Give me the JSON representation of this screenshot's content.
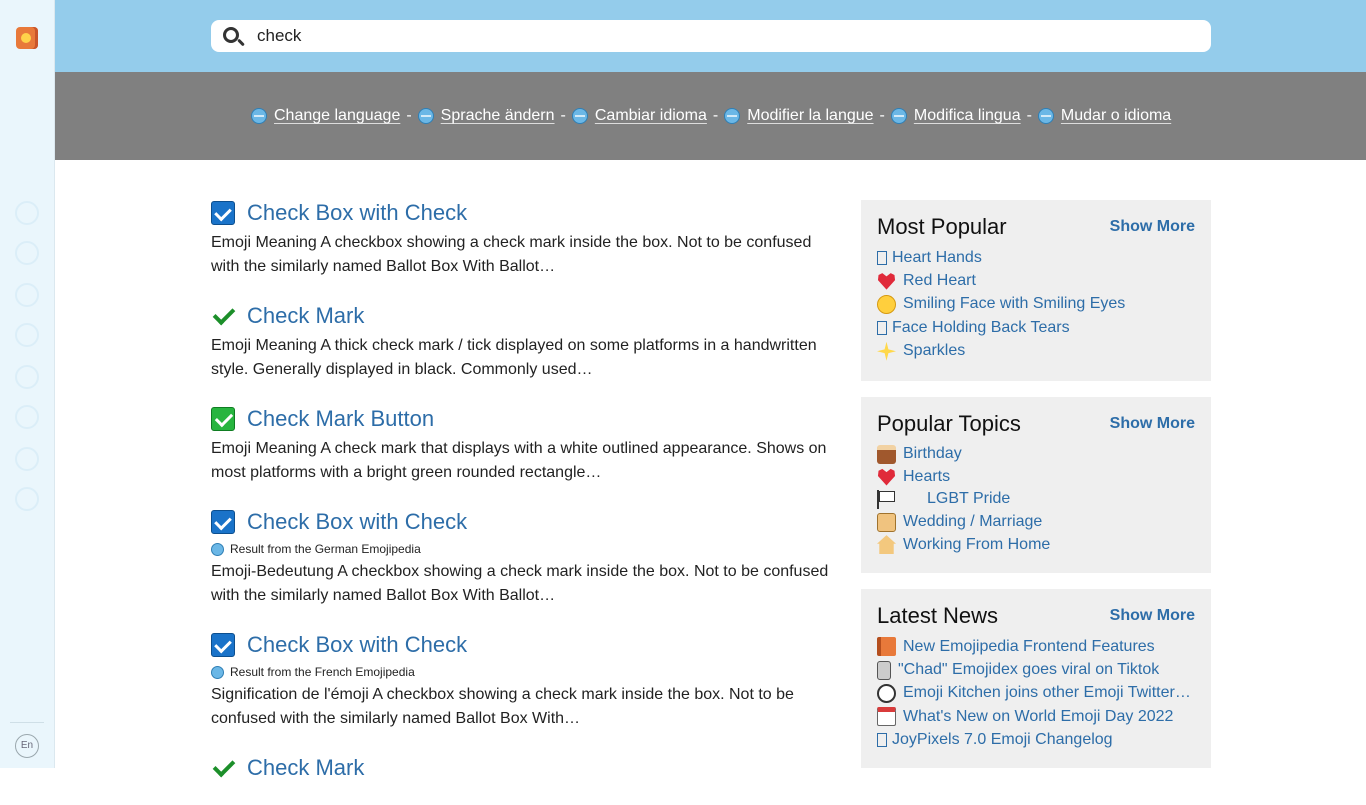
{
  "search": {
    "value": "check",
    "icon": "search-icon"
  },
  "sidebar_rail": {
    "lang_button": "En"
  },
  "languages": [
    {
      "label": "Change language"
    },
    {
      "label": "Sprache ändern"
    },
    {
      "label": "Cambiar idioma"
    },
    {
      "label": "Modifier la langue"
    },
    {
      "label": "Modifica lingua"
    },
    {
      "label": "Mudar o idioma"
    }
  ],
  "results": [
    {
      "title": "Check Box with Check",
      "icon": "check-box-icon",
      "sub": "",
      "desc": "Emoji Meaning A checkbox showing a check mark inside the box. Not to be confused with the similarly named Ballot Box With Ballot…"
    },
    {
      "title": "Check Mark",
      "icon": "check-mark-icon",
      "sub": "",
      "desc": "Emoji Meaning A thick check mark / tick displayed on some platforms in a handwritten style. Generally displayed in black. Commonly used…"
    },
    {
      "title": "Check Mark Button",
      "icon": "check-mark-button-icon",
      "sub": "",
      "desc": "Emoji Meaning A check mark that displays with a white outlined appearance. Shows on most platforms with a bright green rounded rectangle…"
    },
    {
      "title": "Check Box with Check",
      "icon": "check-box-icon",
      "sub": "Result from the German Emojipedia",
      "desc": "Emoji-Bedeutung A checkbox showing a check mark inside the box. Not to be confused with the similarly named Ballot Box With Ballot…"
    },
    {
      "title": "Check Box with Check",
      "icon": "check-box-icon",
      "sub": "Result from the French Emojipedia",
      "desc": "Signification de l'émoji A checkbox showing a check mark inside the box. Not to be confused with the similarly named Ballot Box With…"
    },
    {
      "title": "Check Mark",
      "icon": "check-mark-icon",
      "sub": "",
      "desc": ""
    }
  ],
  "most_popular": {
    "title": "Most Popular",
    "more": "Show More",
    "items": [
      {
        "label": "Heart Hands",
        "icon": "missing-glyph-icon"
      },
      {
        "label": "Red Heart",
        "icon": "red-heart-icon"
      },
      {
        "label": "Smiling Face with Smiling Eyes",
        "icon": "smiling-face-icon"
      },
      {
        "label": "Face Holding Back Tears",
        "icon": "missing-glyph-icon"
      },
      {
        "label": "Sparkles",
        "icon": "sparkles-icon"
      }
    ]
  },
  "popular_topics": {
    "title": "Popular Topics",
    "more": "Show More",
    "items": [
      {
        "label": "Birthday",
        "icon": "birthday-cake-icon"
      },
      {
        "label": "Hearts",
        "icon": "heart-icon"
      },
      {
        "label": "LGBT Pride",
        "icon": "rainbow-flag-icon"
      },
      {
        "label": "Wedding / Marriage",
        "icon": "wedding-icon"
      },
      {
        "label": "Working From Home",
        "icon": "house-icon"
      }
    ]
  },
  "latest_news": {
    "title": "Latest News",
    "more": "Show More",
    "items": [
      {
        "label": "New Emojipedia Frontend Features",
        "icon": "book-icon"
      },
      {
        "label": "\"Chad\" Emojidex goes viral on Tiktok",
        "icon": "phone-icon"
      },
      {
        "label": "Emoji Kitchen joins other Emoji Twitter…",
        "icon": "panda-icon"
      },
      {
        "label": "What's New on World Emoji Day 2022",
        "icon": "calendar-icon"
      },
      {
        "label": "JoyPixels 7.0 Emoji Changelog",
        "icon": "missing-glyph-icon"
      }
    ]
  }
}
